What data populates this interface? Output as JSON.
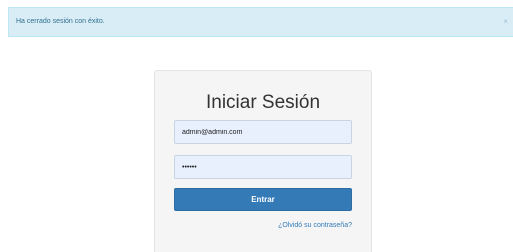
{
  "alert": {
    "message": "Ha cerrado sesión con éxito.",
    "close_label": "×",
    "background": "#d9edf7",
    "text_color": "#31708f"
  },
  "login": {
    "title": "Iniciar Sesión",
    "email_value": "admin@admin.com",
    "password_value": "••••••",
    "submit_label": "Entrar",
    "forgot_link": "¿Olvidó su contraseña?",
    "accent_color": "#337ab7"
  }
}
